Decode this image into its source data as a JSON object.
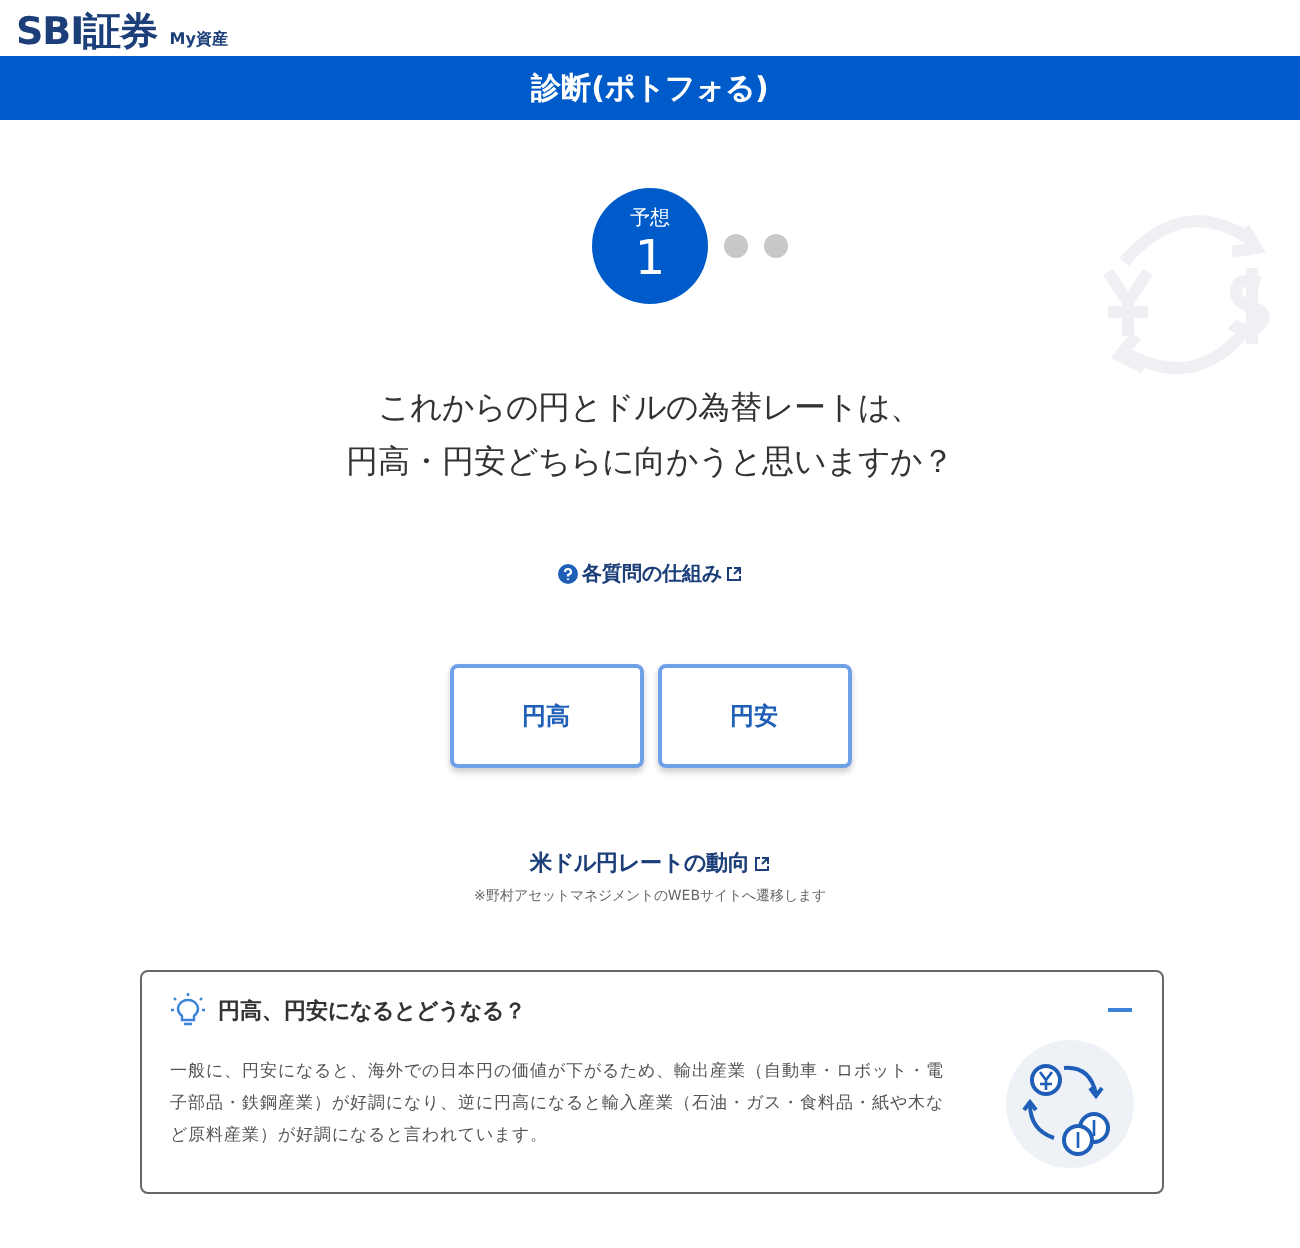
{
  "logo": {
    "brand": "SBI証券",
    "sub": "My資産"
  },
  "title": "診断(ポトフォる)",
  "steps": [
    {
      "label": "予想",
      "number": "1",
      "selected": true
    },
    {
      "selected": false
    },
    {
      "selected": false
    }
  ],
  "question": [
    "これからの円とドルの為替レートは、",
    "円高・円安どちらに向かうと思いますか？"
  ],
  "help_link": "各質問の仕組み",
  "answers": [
    "円高",
    "円安"
  ],
  "rate_link": "米ドル円レートの動向",
  "rate_note": "※野村アセットマネジメントのWEBサイトへ遷移します",
  "info": {
    "title": "円高、円安になるとどうなる？",
    "expanded": true,
    "body": "一般に、円安になると、海外での日本円の価値が下がるため、輸出産業（自動車・ロボット・電子部品・鉄鋼産業）が好調になり、逆に円高になると輸入産業（石油・ガス・食料品・紙や木など原料産業）が好調になると言われています。"
  }
}
